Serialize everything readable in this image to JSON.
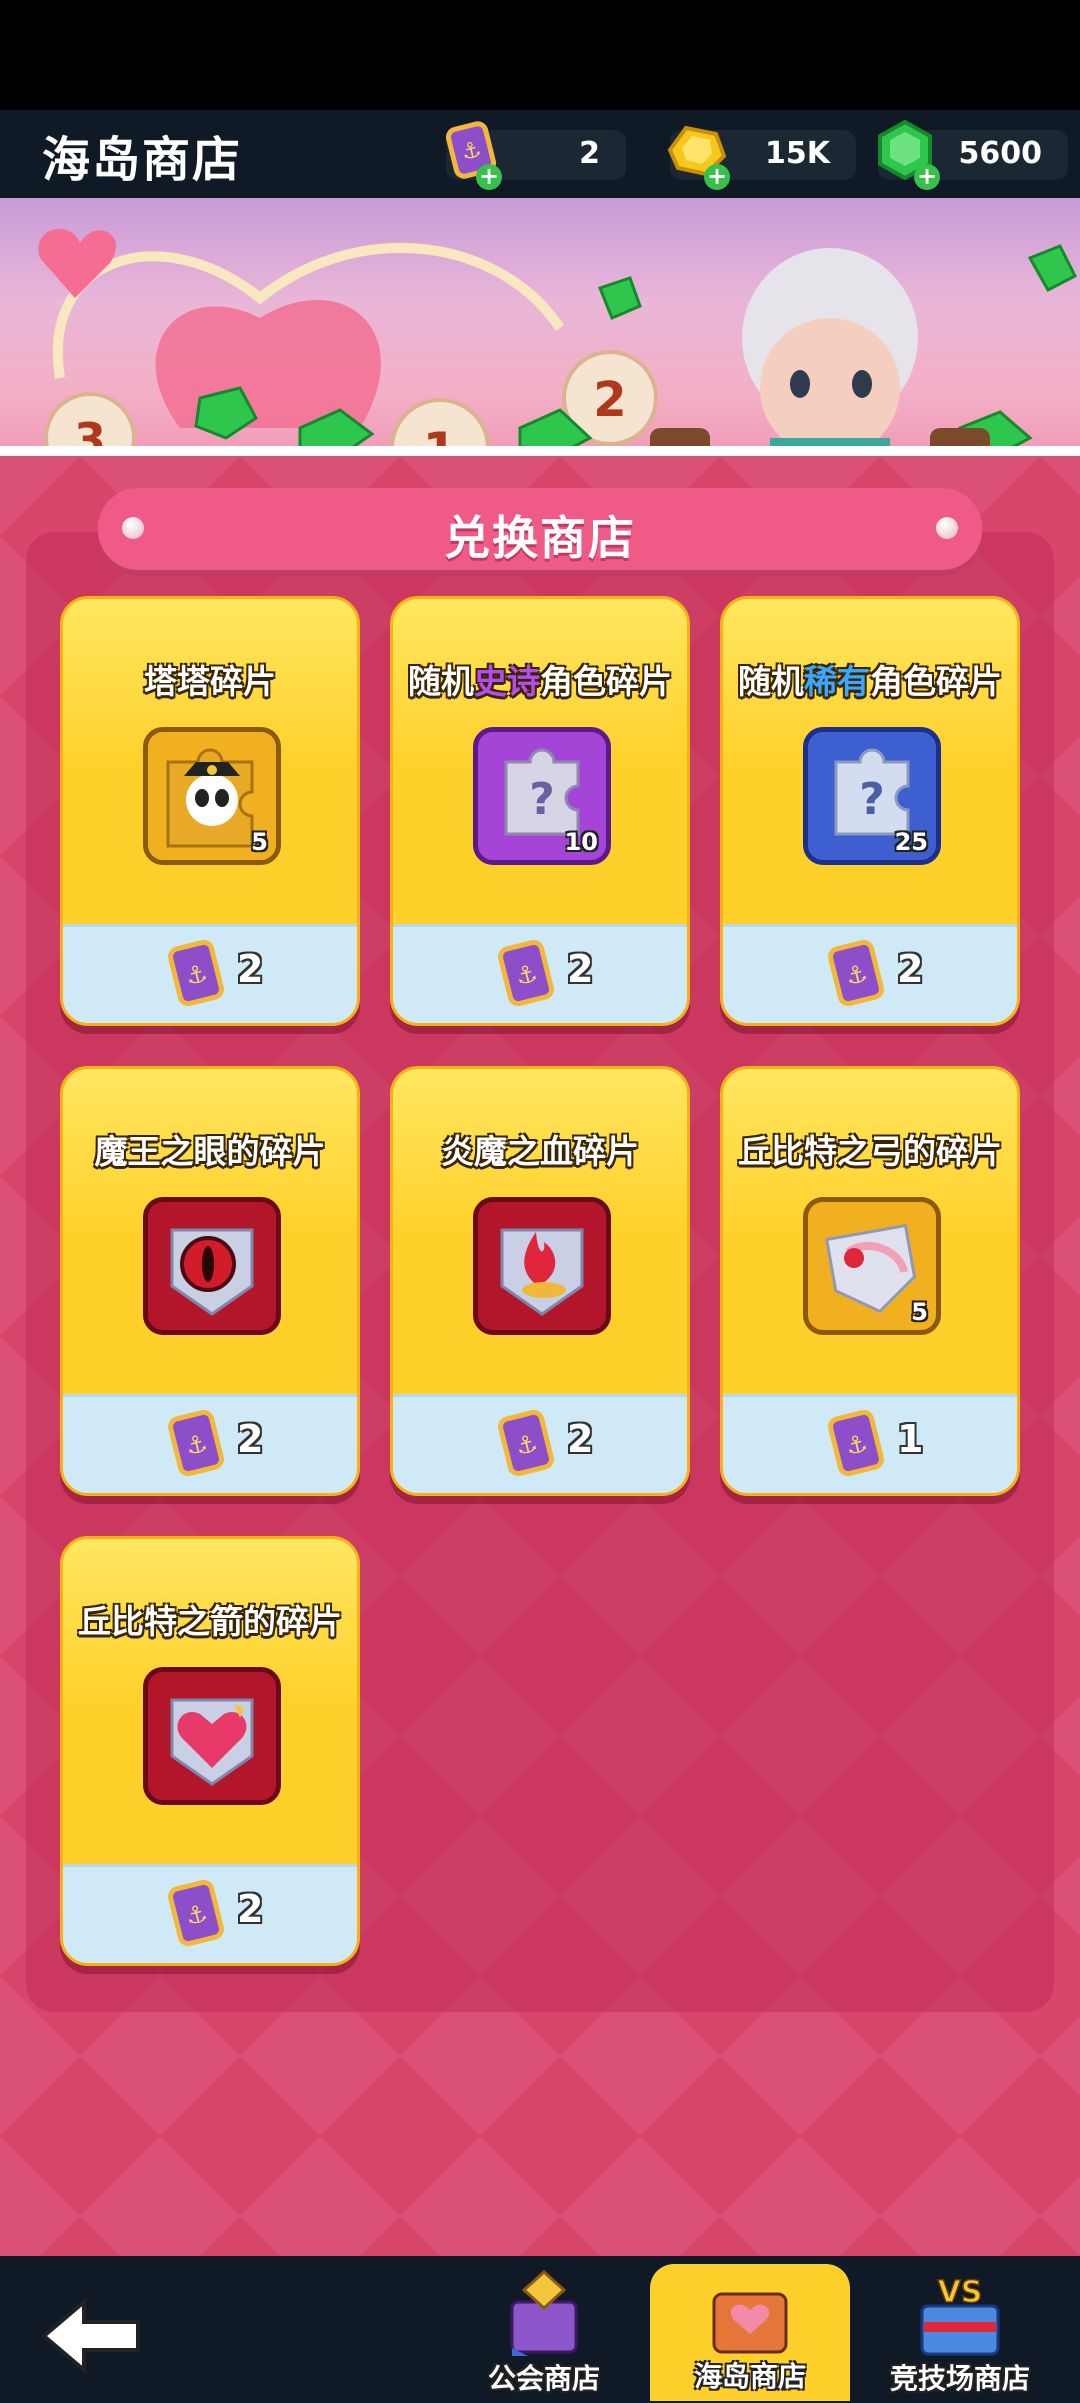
{
  "header": {
    "title": "海岛商店",
    "currencies": [
      {
        "name": "anchor-ticket",
        "value": "2"
      },
      {
        "name": "gold",
        "value": "15K"
      },
      {
        "name": "gems",
        "value": "5600"
      }
    ]
  },
  "shop": {
    "title": "兑换商店",
    "items": [
      {
        "name_parts": [
          "塔塔碎片"
        ],
        "count": "5",
        "price": "2",
        "icon": "pirate-panda-icon"
      },
      {
        "name_parts": [
          "随机",
          "史诗",
          "角色碎片"
        ],
        "count": "10",
        "price": "2",
        "icon": "epic-puzzle-icon"
      },
      {
        "name_parts": [
          "随机",
          "稀有",
          "角色碎片"
        ],
        "count": "25",
        "price": "2",
        "icon": "rare-puzzle-icon"
      },
      {
        "name_parts": [
          "魔王之眼的碎片"
        ],
        "count": "",
        "price": "2",
        "icon": "demon-eye-icon"
      },
      {
        "name_parts": [
          "炎魔之血碎片"
        ],
        "count": "",
        "price": "2",
        "icon": "flame-blood-icon"
      },
      {
        "name_parts": [
          "丘比特之弓的碎片"
        ],
        "count": "5",
        "price": "1",
        "icon": "cupid-bow-icon"
      },
      {
        "name_parts": [
          "丘比特之箭的碎片"
        ],
        "count": "",
        "price": "2",
        "icon": "cupid-arrow-icon"
      }
    ]
  },
  "nav": {
    "tabs": [
      {
        "label": "公会商店",
        "active": false
      },
      {
        "label": "海岛商店",
        "active": true
      },
      {
        "label": "竞技场商店",
        "active": false
      }
    ]
  },
  "colors": {
    "accent": "#ffd02a",
    "background": "#d8466c",
    "epic": "#b44cf2",
    "rare": "#3aa6ff"
  }
}
